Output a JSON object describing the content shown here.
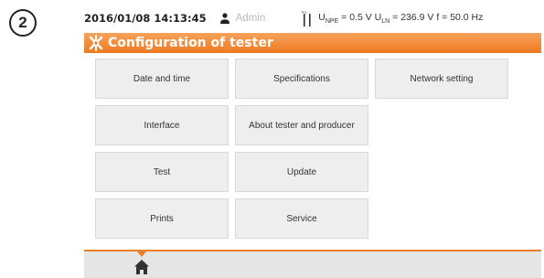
{
  "step_badge": "2",
  "status": {
    "datetime": "2016/01/08 14:13:45",
    "user_icon": "user-icon",
    "user": "Admin",
    "plug_icon": "plug-ln-icon",
    "measurement": {
      "upe_label": "U",
      "upe_sub": "NPE",
      "upe_value": "= 0.5 V",
      "uln_label": "U",
      "uln_sub": "LN",
      "uln_value": "= 236.9 V",
      "freq": "f = 50.0 Hz"
    }
  },
  "title": {
    "icon": "tools-icon",
    "text": "Configuration of tester"
  },
  "menu": {
    "date_time": "Date and time",
    "specifications": "Specifications",
    "network_setting": "Network setting",
    "interface": "Interface",
    "about": "About tester and producer",
    "test": "Test",
    "update": "Update",
    "prints": "Prints",
    "service": "Service"
  },
  "bottom": {
    "home_icon": "home-icon"
  },
  "colors": {
    "accent": "#f07e26",
    "tile_bg": "#eeeeee",
    "bottom_bg": "#e5e5e5"
  }
}
